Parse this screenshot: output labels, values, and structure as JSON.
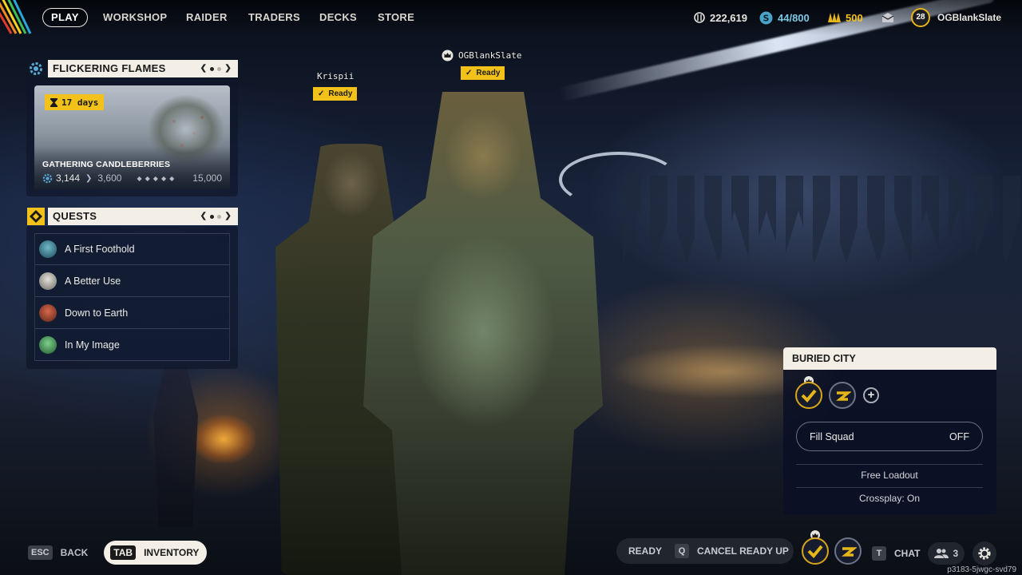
{
  "nav": {
    "items": [
      "PLAY",
      "WORKSHOP",
      "RAIDER",
      "TRADERS",
      "DECKS",
      "STORE"
    ],
    "active": "PLAY"
  },
  "currencies": {
    "coins": "222,619",
    "tokens": "44/800",
    "credits": "500"
  },
  "profile": {
    "level": "28",
    "username": "OGBlankSlate"
  },
  "event": {
    "title": "FLICKERING FLAMES",
    "days_left": "17 days",
    "name": "GATHERING CANDLEBERRIES",
    "progress_current": "3,144",
    "progress_next": "3,600",
    "progress_max": "15,000"
  },
  "quests": {
    "title": "QUESTS",
    "items": [
      {
        "label": "A First Foothold",
        "icon": "quest-avatar-icon"
      },
      {
        "label": "A Better Use",
        "icon": "quest-avatar-icon"
      },
      {
        "label": "Down to Earth",
        "icon": "quest-avatar-icon"
      },
      {
        "label": "In My Image",
        "icon": "quest-avatar-icon"
      }
    ]
  },
  "players": [
    {
      "name": "Krispii",
      "status": "Ready"
    },
    {
      "name": "OGBlankSlate",
      "status": "Ready"
    }
  ],
  "squad": {
    "map": "BURIED CITY",
    "fill_squad_label": "Fill Squad",
    "fill_squad_value": "OFF",
    "loadout": "Free Loadout",
    "crossplay": "Crossplay: On"
  },
  "bottom": {
    "back_key": "ESC",
    "back_label": "BACK",
    "inventory_key": "TAB",
    "inventory_label": "INVENTORY",
    "ready_label": "READY",
    "cancel_key": "Q",
    "cancel_label": "CANCEL READY UP",
    "chat_key": "T",
    "chat_label": "CHAT",
    "squad_count": "3"
  },
  "build_id": "p3183-5jwgc-svd79",
  "colors": {
    "accent_yellow": "#f2c21a",
    "panel_header": "#f3efe6",
    "panel_bg": "#0f162a"
  }
}
